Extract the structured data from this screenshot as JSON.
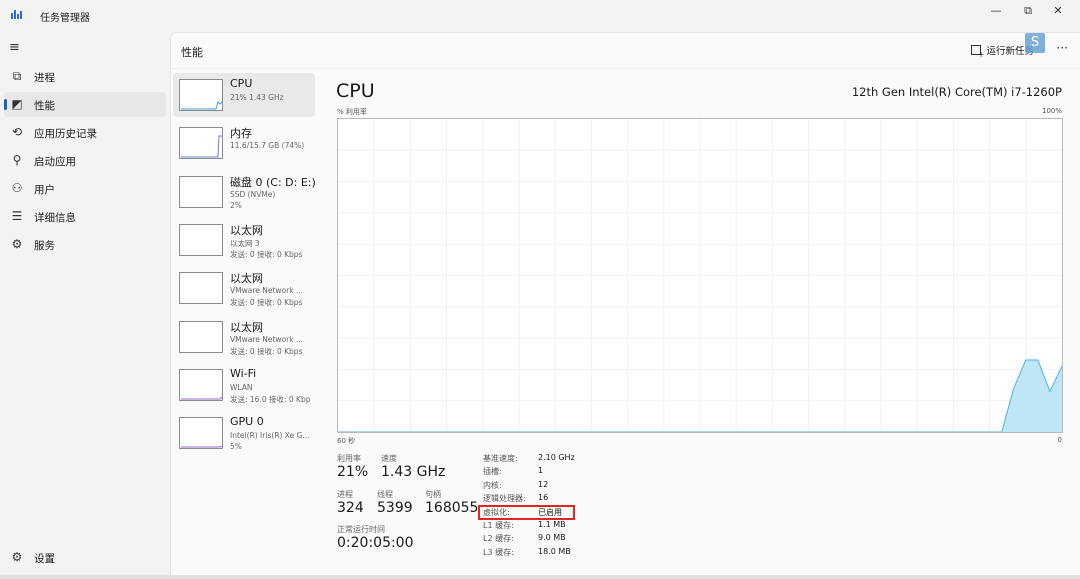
{
  "window": {
    "title": "任务管理器",
    "controls": {
      "minimize": "—",
      "restore": "⧉",
      "close": "✕"
    }
  },
  "nav": {
    "menu_icon": "hamburger-icon",
    "items": [
      {
        "label": "进程",
        "icon": "processes-icon",
        "glyph": "⧉",
        "active": false
      },
      {
        "label": "性能",
        "icon": "performance-icon",
        "glyph": "◩",
        "active": true
      },
      {
        "label": "应用历史记录",
        "icon": "history-icon",
        "glyph": "⟲",
        "active": false
      },
      {
        "label": "启动应用",
        "icon": "startup-icon",
        "glyph": "⚲",
        "active": false
      },
      {
        "label": "用户",
        "icon": "users-icon",
        "glyph": "⚇",
        "active": false
      },
      {
        "label": "详细信息",
        "icon": "details-icon",
        "glyph": "☰",
        "active": false
      },
      {
        "label": "服务",
        "icon": "services-icon",
        "glyph": "⚙",
        "active": false
      }
    ],
    "settings": {
      "label": "设置",
      "icon": "settings-icon",
      "glyph": "⚙"
    }
  },
  "header": {
    "title": "性能",
    "run_task": "运行新任务",
    "more": "···"
  },
  "devices": [
    {
      "name": "CPU",
      "line1": "21% 1.43 GHz",
      "line2": "",
      "active": true
    },
    {
      "name": "内存",
      "line1": "11.6/15.7 GB (74%)",
      "line2": "",
      "active": false
    },
    {
      "name": "磁盘 0 (C: D: E:)",
      "line1": "SSD (NVMe)",
      "line2": "2%",
      "active": false
    },
    {
      "name": "以太网",
      "line1": "以太网 3",
      "line2": "发送: 0 接收: 0 Kbps",
      "active": false
    },
    {
      "name": "以太网",
      "line1": "VMware Network ...",
      "line2": "发送: 0 接收: 0 Kbps",
      "active": false
    },
    {
      "name": "以太网",
      "line1": "VMware Network ...",
      "line2": "发送: 0 接收: 0 Kbps",
      "active": false
    },
    {
      "name": "Wi-Fi",
      "line1": "WLAN",
      "line2": "发送: 16.0 接收: 0 Kbp",
      "active": false
    },
    {
      "name": "GPU 0",
      "line1": "Intel(R) Iris(R) Xe G...",
      "line2": "5%",
      "active": false
    }
  ],
  "detail": {
    "title": "CPU",
    "model": "12th Gen Intel(R) Core(TM) i7-1260P",
    "graph_label_left": "% 利用率",
    "graph_label_right": "100%",
    "x_label_left": "60 秒",
    "x_label_right": "0",
    "stats": {
      "utilization_label": "利用率",
      "utilization": "21%",
      "speed_label": "速度",
      "speed": "1.43 GHz",
      "processes_label": "进程",
      "processes": "324",
      "threads_label": "线程",
      "threads": "5399",
      "handles_label": "句柄",
      "handles": "168055",
      "uptime_label": "正常运行时间",
      "uptime": "0:20:05:00"
    },
    "specs": [
      {
        "key": "基准速度:",
        "value": "2.10 GHz"
      },
      {
        "key": "插槽:",
        "value": "1"
      },
      {
        "key": "内核:",
        "value": "12"
      },
      {
        "key": "逻辑处理器:",
        "value": "16"
      },
      {
        "key": "虚拟化:",
        "value": "已启用"
      },
      {
        "key": "L1 缓存:",
        "value": "1.1 MB"
      },
      {
        "key": "L2 缓存:",
        "value": "9.0 MB"
      },
      {
        "key": "L3 缓存:",
        "value": "18.0 MB"
      }
    ]
  },
  "chart_data": {
    "type": "area",
    "x": [
      0,
      1,
      2,
      3,
      4,
      5,
      6,
      7,
      8,
      9,
      10,
      11,
      12,
      13,
      14,
      15,
      16,
      17,
      18,
      19,
      20,
      21,
      22,
      23,
      24,
      25,
      26,
      27,
      28,
      29,
      30,
      31,
      32,
      33,
      34,
      35,
      36,
      37,
      38,
      39,
      40,
      41,
      42,
      43,
      44,
      45,
      46,
      47,
      48,
      49,
      50,
      51,
      52,
      53,
      54,
      55,
      56,
      57,
      58,
      59,
      60
    ],
    "values": [
      0,
      0,
      0,
      0,
      0,
      0,
      0,
      0,
      0,
      0,
      0,
      0,
      0,
      0,
      0,
      0,
      0,
      0,
      0,
      0,
      0,
      0,
      0,
      0,
      0,
      0,
      0,
      0,
      0,
      0,
      0,
      0,
      0,
      0,
      0,
      0,
      0,
      0,
      0,
      0,
      0,
      0,
      0,
      0,
      0,
      0,
      0,
      0,
      0,
      0,
      0,
      0,
      0,
      0,
      0,
      0,
      14,
      23,
      23,
      13,
      21
    ],
    "xlim": [
      0,
      60
    ],
    "ylim": [
      0,
      100
    ],
    "grid": true,
    "fill_color": "#bfe6f6",
    "line_color": "#4cb3e6"
  }
}
